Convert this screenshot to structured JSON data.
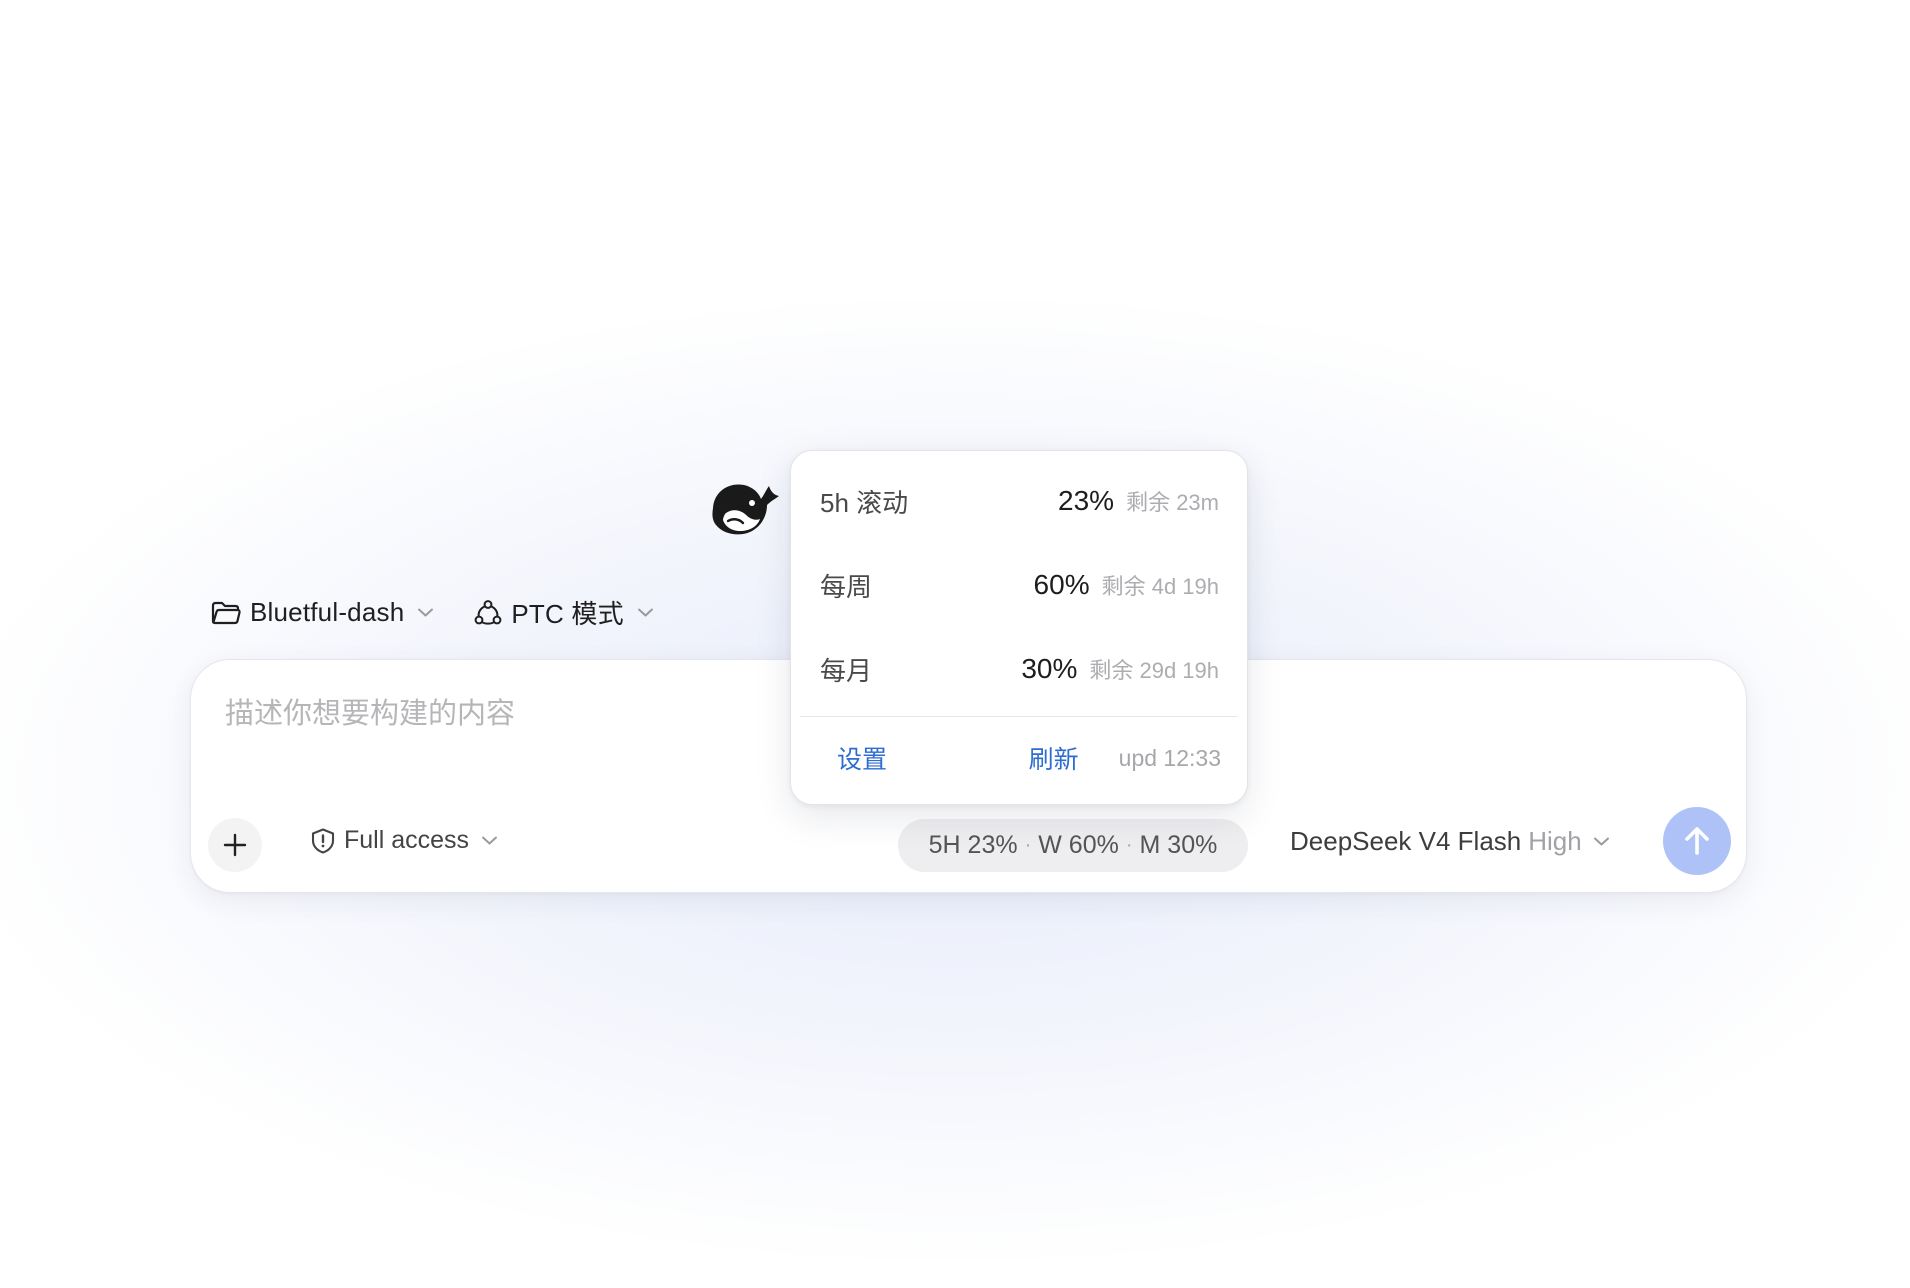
{
  "app": {
    "logo_icon": "whale-logo-icon",
    "colors": {
      "accent": "#2f6cd2",
      "send_button": "#aec2f7",
      "logo": "#1a1a1a"
    }
  },
  "toolbar": {
    "project": {
      "icon": "folder-icon",
      "label": "Bluetful-dash"
    },
    "mode": {
      "icon": "ptc-mode-icon",
      "label": "PTC 模式"
    }
  },
  "composer": {
    "placeholder": "描述你想要构建的内容",
    "value": "",
    "add_icon": "plus-icon",
    "access": {
      "icon": "shield-alert-icon",
      "label": "Full access"
    },
    "usage_summary": {
      "h5": "5H 23%",
      "week": "W 60%",
      "month": "M 30%",
      "separator": "·"
    },
    "model": {
      "name": "DeepSeek V4 Flash",
      "level": "High"
    },
    "send_icon": "arrow-up-icon"
  },
  "usage_popover": {
    "rows": [
      {
        "label": "5h 滚动",
        "percent": "23%",
        "remaining": "剩余 23m"
      },
      {
        "label": "每周",
        "percent": "60%",
        "remaining": "剩余 4d 19h"
      },
      {
        "label": "每月",
        "percent": "30%",
        "remaining": "剩余 29d 19h"
      }
    ],
    "settings_label": "设置",
    "refresh_label": "刷新",
    "updated": "upd 12:33"
  }
}
